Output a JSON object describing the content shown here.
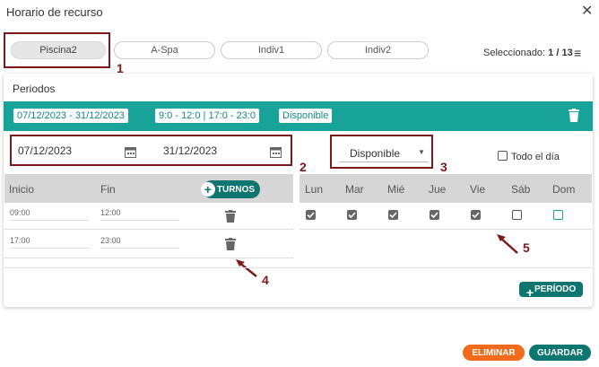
{
  "dialog": {
    "title": "Horario de recurso"
  },
  "tabs": [
    {
      "label": "Piscina2",
      "active": true
    },
    {
      "label": "A-Spa",
      "active": false
    },
    {
      "label": "Indiv1",
      "active": false
    },
    {
      "label": "Indiv2",
      "active": false
    }
  ],
  "selection": {
    "label": "Seleccionado:",
    "count": "1 / 13"
  },
  "periods": {
    "title": "Periodos",
    "summary": {
      "date_range": "07/12/2023 - 31/12/2023",
      "time_range": "9:0 - 12:0 | 17:0 - 23:0",
      "status": "Disponible"
    },
    "start_date": "07/12/2023",
    "end_date": "31/12/2023",
    "availability_select": "Disponible",
    "all_day_label": "Todo el día",
    "all_day_checked": false
  },
  "shifts": {
    "col_start": "Inicio",
    "col_end": "Fin",
    "add_label": "TURNOS",
    "rows": [
      {
        "start": "09:00",
        "end": "12:00"
      },
      {
        "start": "17:00",
        "end": "23:00"
      }
    ]
  },
  "weekdays": {
    "labels": [
      "Lun",
      "Mar",
      "Mié",
      "Jue",
      "Vie",
      "Sáb",
      "Dom"
    ],
    "checked": [
      true,
      true,
      true,
      true,
      true,
      false,
      false
    ]
  },
  "annotations": [
    "1",
    "2",
    "3",
    "4",
    "5"
  ],
  "buttons": {
    "add_period": "PERÍODO",
    "delete": "ELIMINAR",
    "save": "GUARDAR"
  },
  "colors": {
    "teal": "#17a398",
    "dark_teal": "#0e7670",
    "orange": "#f26a1b",
    "annotation": "#7b1a1a"
  }
}
